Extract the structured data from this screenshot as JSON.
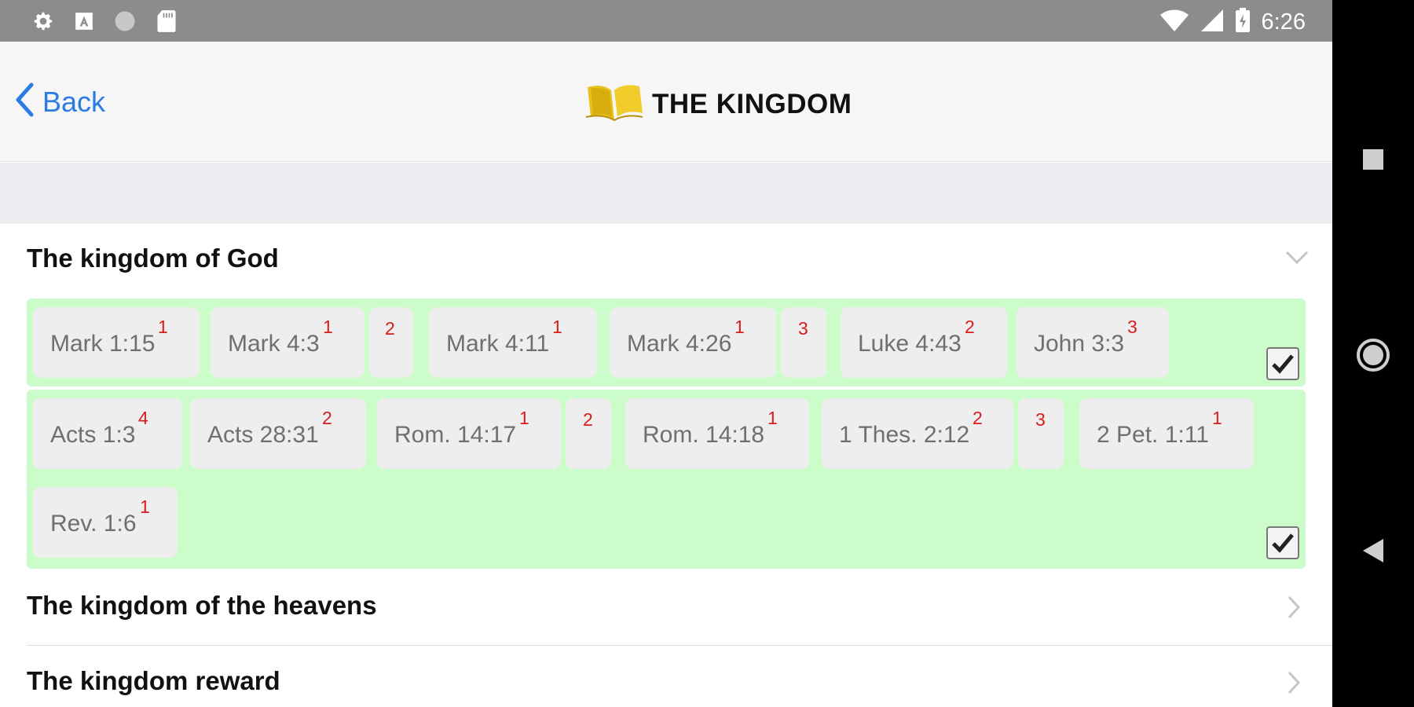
{
  "status_bar": {
    "time": "6:26",
    "left_icons": [
      "gear-icon",
      "a-icon",
      "circle-icon",
      "sd-card-icon"
    ],
    "right_icons": [
      "wifi-icon",
      "signal-icon",
      "battery-icon"
    ]
  },
  "header": {
    "back_label": "Back",
    "title": "THE KINGDOM",
    "logo": "book-icon"
  },
  "sections": [
    {
      "title": "The kingdom of God",
      "expanded": true
    },
    {
      "title": "The kingdom of the heavens",
      "expanded": false
    },
    {
      "title": "The kingdom reward",
      "expanded": false
    }
  ],
  "group1": {
    "tags": [
      {
        "ref": "Mark 1:15",
        "sup": "1"
      },
      {
        "ref": "Mark 4:3",
        "sup": "1",
        "extra": "2"
      },
      {
        "ref": "Mark 4:11",
        "sup": "1"
      },
      {
        "ref": "Mark 4:26",
        "sup": "1",
        "extra": "3"
      },
      {
        "ref": "Luke 4:43",
        "sup": "2"
      },
      {
        "ref": "John 3:3",
        "sup": "3"
      }
    ],
    "checked": true
  },
  "group2": {
    "tags": [
      {
        "ref": "Acts 1:3",
        "sup": "4"
      },
      {
        "ref": "Acts 28:31",
        "sup": "2"
      },
      {
        "ref": "Rom. 14:17",
        "sup": "1",
        "extra": "2"
      },
      {
        "ref": "Rom. 14:18",
        "sup": "1"
      },
      {
        "ref": "1 Thes. 2:12",
        "sup": "2",
        "extra": "3"
      },
      {
        "ref": "2 Pet. 1:11",
        "sup": "1"
      },
      {
        "ref": "Rev. 1:6",
        "sup": "1"
      }
    ],
    "checked": true
  },
  "colors": {
    "accent": "#2a7be4",
    "group_bg": "#ccfcca",
    "sup": "#d81c1c"
  },
  "nav_bar": [
    "recents-square-icon",
    "home-circle-icon",
    "back-triangle-icon"
  ]
}
